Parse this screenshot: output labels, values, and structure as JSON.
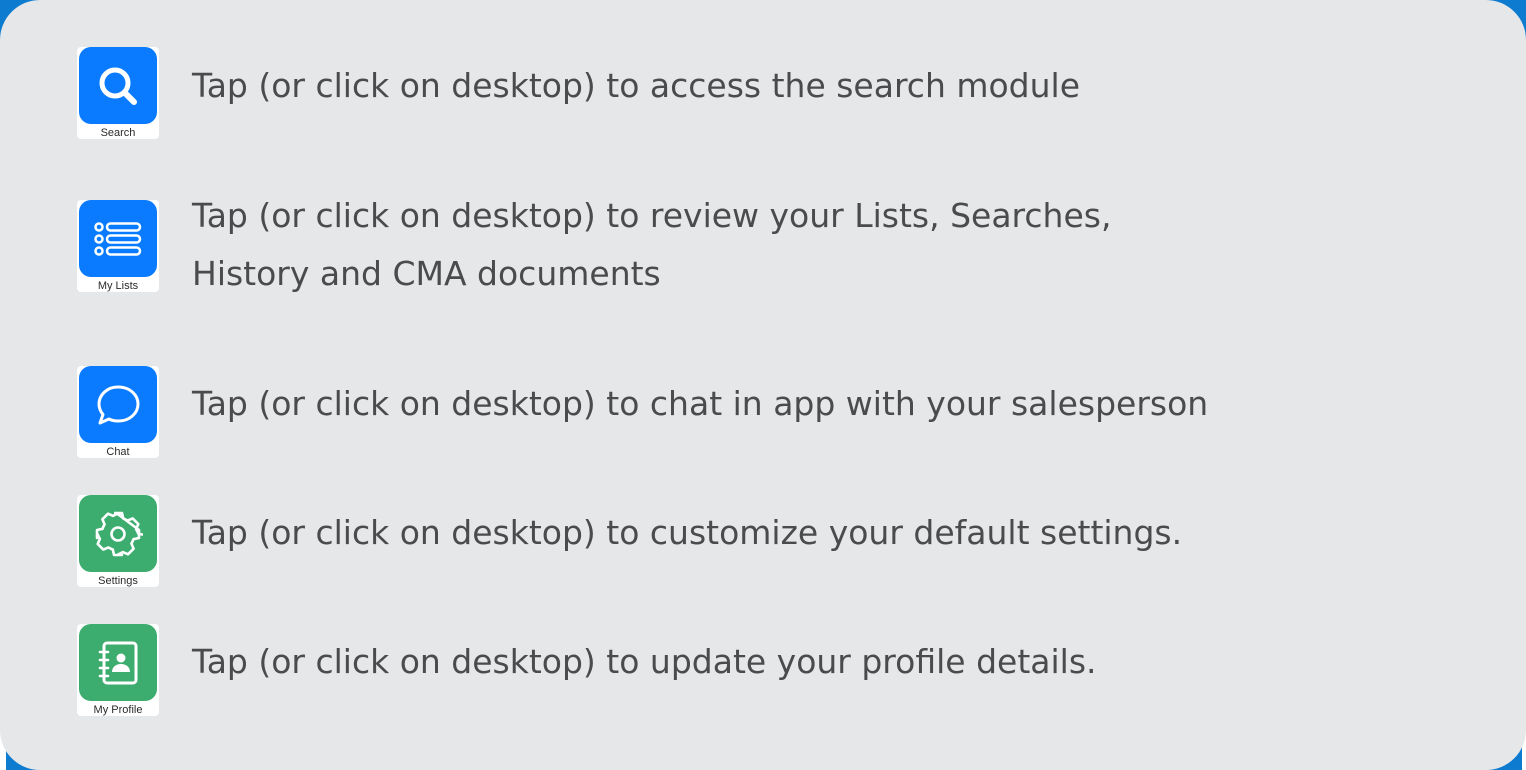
{
  "items": [
    {
      "icon": "search-icon",
      "icon_caption": "Search",
      "icon_color": "#0a7bff",
      "text": "Tap (or click on desktop) to access the search module"
    },
    {
      "icon": "list-icon",
      "icon_caption": "My Lists",
      "icon_color": "#0a7bff",
      "text_line1": "Tap (or click on desktop) to review your Lists, Searches,",
      "text_line2": "History and CMA documents"
    },
    {
      "icon": "chat-bubble-icon",
      "icon_caption": "Chat",
      "icon_color": "#0a7bff",
      "text": "Tap (or click on desktop) to chat in app with your salesperson"
    },
    {
      "icon": "gear-icon",
      "icon_caption": "Settings",
      "icon_color": "#3dac6f",
      "text": "Tap (or click on desktop) to customize your default settings."
    },
    {
      "icon": "contact-book-icon",
      "icon_caption": "My Profile",
      "icon_color": "#3dac6f",
      "text": "Tap (or click on desktop) to update your profile details."
    }
  ],
  "colors": {
    "frame_blue": "#0d7bd0",
    "panel_bg": "#e6e7e9",
    "text": "#4a4b4d"
  }
}
